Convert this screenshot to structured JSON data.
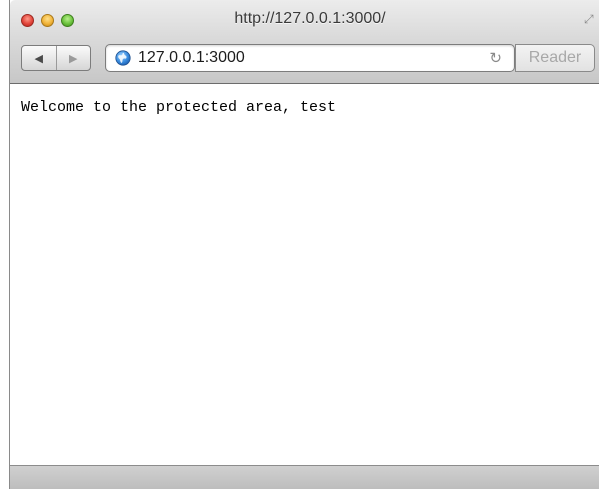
{
  "window": {
    "title": "http://127.0.0.1:3000/"
  },
  "toolbar": {
    "back_icon": "back-arrow-icon",
    "forward_icon": "forward-arrow-icon",
    "address_value": "127.0.0.1:3000",
    "reload_icon": "reload-icon",
    "reader_label": "Reader"
  },
  "page": {
    "message": "Welcome to the protected area, test"
  },
  "colors": {
    "close": "#e2463c",
    "minimize": "#f1b43a",
    "zoom": "#6cc33e",
    "reader_text": "#a8a8a8"
  }
}
